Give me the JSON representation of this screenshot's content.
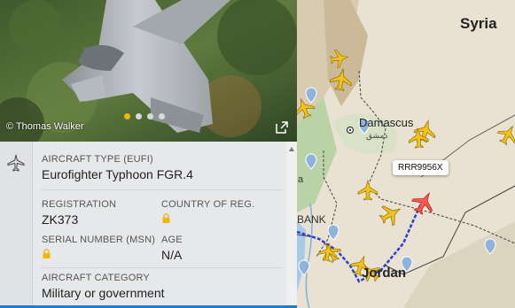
{
  "photo": {
    "credit": "© Thomas Walker",
    "dots_count": 4,
    "active_dot": 0
  },
  "panel": {
    "aircraft_type_label": "AIRCRAFT TYPE",
    "aircraft_type_code": "(EUFI)",
    "aircraft_type_value": "Eurofighter Typhoon FGR.4",
    "registration_label": "REGISTRATION",
    "registration_value": "ZK373",
    "country_label": "COUNTRY OF REG.",
    "serial_label": "SERIAL NUMBER (MSN)",
    "age_label": "AGE",
    "age_value": "N/A",
    "category_label": "AIRCRAFT CATEGORY",
    "category_value": "Military or government"
  },
  "map": {
    "country_label": "Syria",
    "city_label": "Damascus",
    "city_arabic": "دمشق",
    "west_bank_label": "BANK",
    "fa_label": "a",
    "jordan_label": "Jordan",
    "selected_callsign": "RRR9956X"
  },
  "colors": {
    "accent": "#f2b705",
    "aircraft": "#f2c21b",
    "selected_aircraft": "#ff5a4f",
    "track": "#2b3fd4",
    "info_blue": "#1e7bd4"
  }
}
